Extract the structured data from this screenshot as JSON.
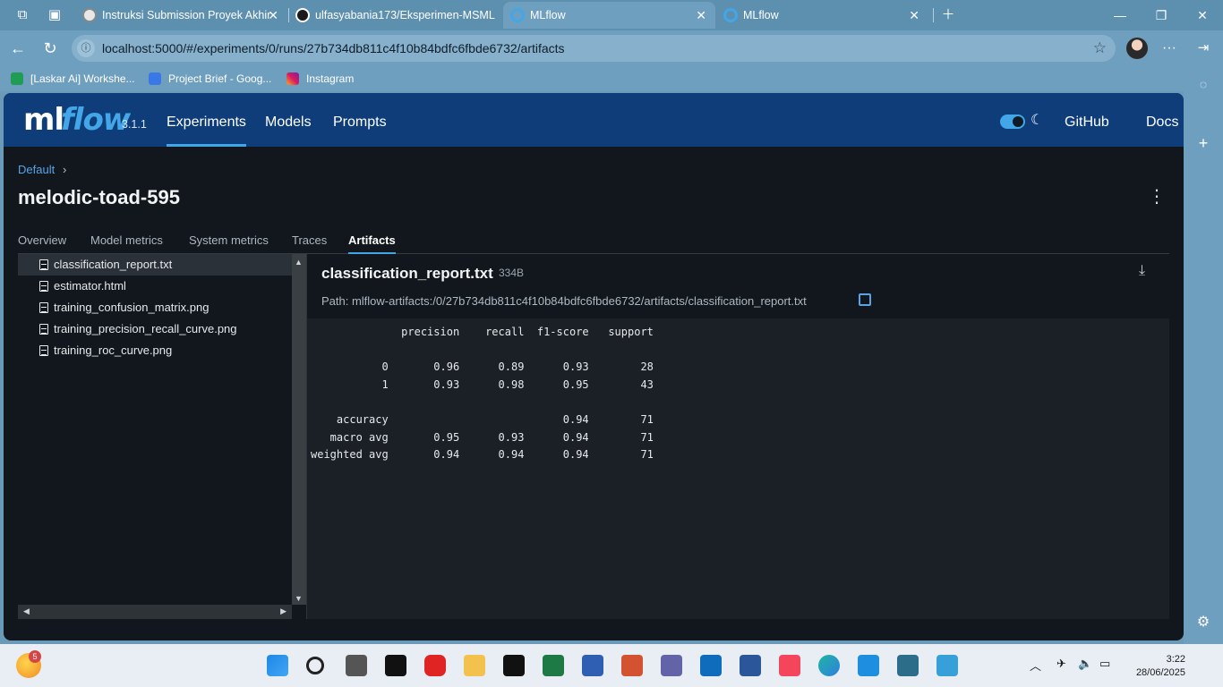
{
  "browser": {
    "tabs": [
      {
        "title": "Instruksi Submission Proyek Akhir",
        "active": false
      },
      {
        "title": "ulfasyabania173/Eksperimen-MSML",
        "active": false
      },
      {
        "title": "MLflow",
        "active": true
      },
      {
        "title": "MLflow",
        "active": false
      }
    ],
    "url": "localhost:5000/#/experiments/0/runs/27b734db811c4f10b84bdfc6fbde6732/artifacts",
    "bookmarks": [
      "[Laskar Ai] Workshe...",
      "Project Brief - Goog...",
      "Instagram"
    ]
  },
  "mlflow": {
    "logo_ml": "ml",
    "logo_flow": "flow",
    "version": "3.1.1",
    "nav": [
      "Experiments",
      "Models",
      "Prompts"
    ],
    "right_nav": [
      "GitHub",
      "Docs"
    ],
    "breadcrumb": "Default",
    "breadcrumb_sep": "›",
    "run_name": "melodic-toad-595",
    "run_tabs": [
      "Overview",
      "Model metrics",
      "System metrics",
      "Traces",
      "Artifacts"
    ],
    "files": [
      "classification_report.txt",
      "estimator.html",
      "training_confusion_matrix.png",
      "training_precision_recall_curve.png",
      "training_roc_curve.png"
    ],
    "viewer": {
      "filename": "classification_report.txt",
      "size": "334B",
      "path": "Path: mlflow-artifacts:/0/27b734db811c4f10b84bdfc6fbde6732/artifacts/classification_report.txt",
      "content": "              precision    recall  f1-score   support\n\n           0       0.96      0.89      0.93        28\n           1       0.93      0.98      0.95        43\n\n    accuracy                           0.94        71\n   macro avg       0.95      0.93      0.94        71\nweighted avg       0.94      0.94      0.94        71"
    }
  },
  "taskbar": {
    "time": "3:22",
    "date": "28/06/2025",
    "notification_count": "5"
  }
}
